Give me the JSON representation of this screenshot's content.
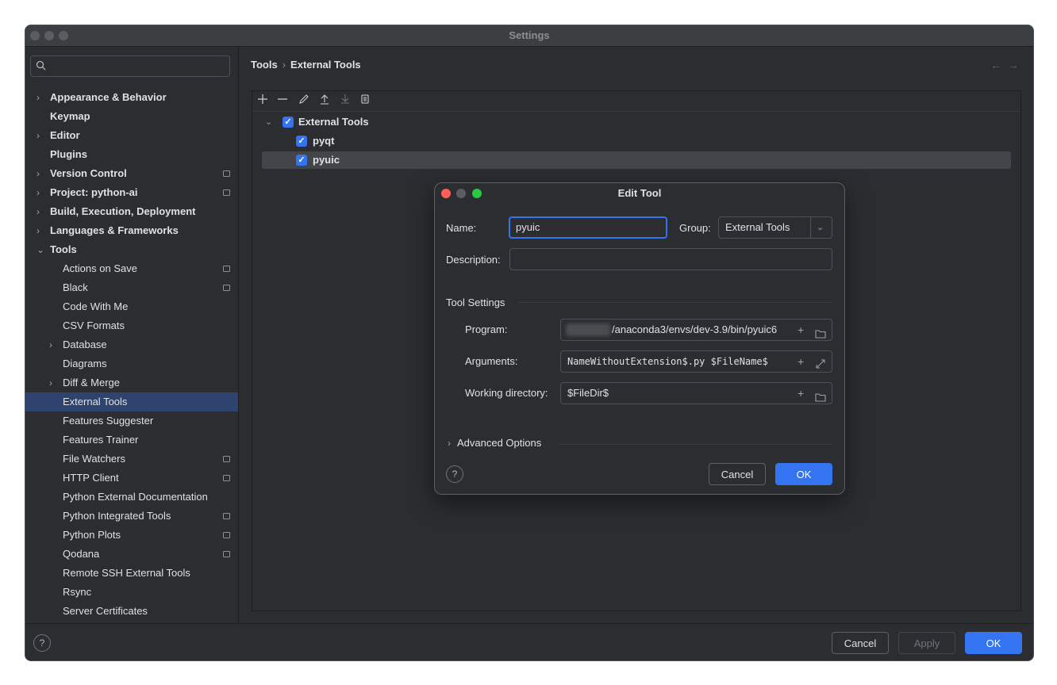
{
  "window": {
    "title": "Settings"
  },
  "search": {
    "placeholder": ""
  },
  "sidebar": {
    "items": [
      {
        "label": "Appearance & Behavior",
        "expandable": true,
        "bold": true,
        "level": 0
      },
      {
        "label": "Keymap",
        "bold": true,
        "level": 0
      },
      {
        "label": "Editor",
        "expandable": true,
        "bold": true,
        "level": 0
      },
      {
        "label": "Plugins",
        "bold": true,
        "level": 0
      },
      {
        "label": "Version Control",
        "expandable": true,
        "bold": true,
        "level": 0,
        "badge": true
      },
      {
        "label": "Project: python-ai",
        "expandable": true,
        "bold": true,
        "level": 0,
        "badge": true
      },
      {
        "label": "Build, Execution, Deployment",
        "expandable": true,
        "bold": true,
        "level": 0
      },
      {
        "label": "Languages & Frameworks",
        "expandable": true,
        "bold": true,
        "level": 0
      },
      {
        "label": "Tools",
        "expanded": true,
        "bold": true,
        "level": 0
      },
      {
        "label": "Actions on Save",
        "level": 1,
        "badge": true
      },
      {
        "label": "Black",
        "level": 1,
        "badge": true
      },
      {
        "label": "Code With Me",
        "level": 1
      },
      {
        "label": "CSV Formats",
        "level": 1
      },
      {
        "label": "Database",
        "expandable": true,
        "level": 1
      },
      {
        "label": "Diagrams",
        "level": 1
      },
      {
        "label": "Diff & Merge",
        "expandable": true,
        "level": 1
      },
      {
        "label": "External Tools",
        "level": 1,
        "selected": true
      },
      {
        "label": "Features Suggester",
        "level": 1
      },
      {
        "label": "Features Trainer",
        "level": 1
      },
      {
        "label": "File Watchers",
        "level": 1,
        "badge": true
      },
      {
        "label": "HTTP Client",
        "level": 1,
        "badge": true
      },
      {
        "label": "Python External Documentation",
        "level": 1
      },
      {
        "label": "Python Integrated Tools",
        "level": 1,
        "badge": true
      },
      {
        "label": "Python Plots",
        "level": 1,
        "badge": true
      },
      {
        "label": "Qodana",
        "level": 1,
        "badge": true
      },
      {
        "label": "Remote SSH External Tools",
        "level": 1
      },
      {
        "label": "Rsync",
        "level": 1
      },
      {
        "label": "Server Certificates",
        "level": 1
      }
    ]
  },
  "breadcrumb": {
    "parent": "Tools",
    "separator": "›",
    "current": "External Tools"
  },
  "tree": {
    "group": {
      "label": "External Tools",
      "checked": true
    },
    "items": [
      {
        "label": "pyqt",
        "checked": true
      },
      {
        "label": "pyuic",
        "checked": true,
        "selected": true
      }
    ]
  },
  "dialog": {
    "title": "Edit Tool",
    "name_label": "Name:",
    "name_value": "pyuic",
    "group_label": "Group:",
    "group_value": "External Tools",
    "description_label": "Description:",
    "description_value": "",
    "section_title": "Tool Settings",
    "program_label": "Program:",
    "program_value": "/anaconda3/envs/dev-3.9/bin/pyuic6",
    "arguments_label": "Arguments:",
    "arguments_value": "NameWithoutExtension$.py $FileName$",
    "workdir_label": "Working directory:",
    "workdir_value": "$FileDir$",
    "advanced_label": "Advanced Options",
    "cancel_label": "Cancel",
    "ok_label": "OK"
  },
  "footer": {
    "cancel_label": "Cancel",
    "apply_label": "Apply",
    "ok_label": "OK"
  },
  "colors": {
    "accent": "#3574f0",
    "background": "#2b2d30",
    "selection": "#2e436e",
    "close": "#ff5f57",
    "minimize": "#5a5d61",
    "zoom": "#28c840"
  }
}
